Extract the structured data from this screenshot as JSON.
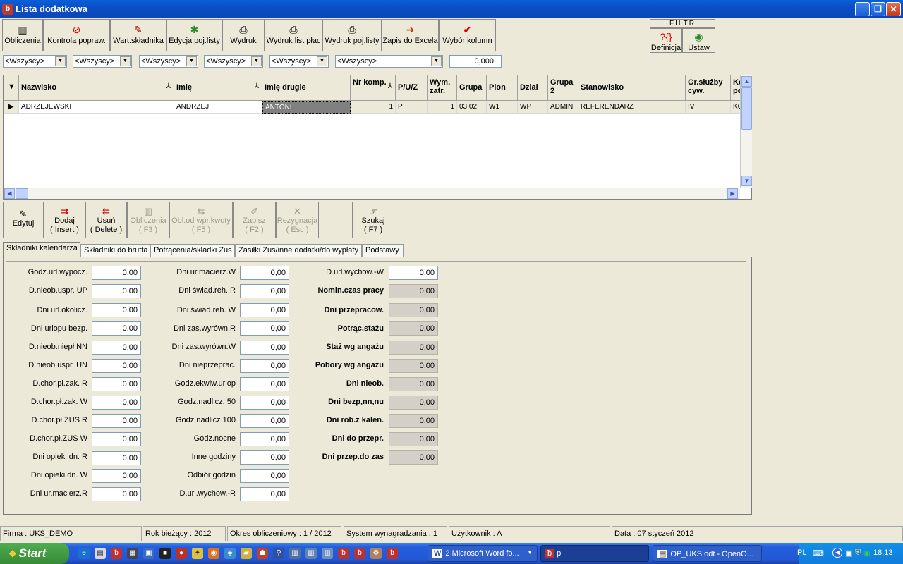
{
  "window": {
    "title": "Lista dodatkowa",
    "app_icon": "app-logo-icon"
  },
  "toolbar": [
    {
      "label": "Obliczenia",
      "icon": "calculator-icon",
      "enabled": true
    },
    {
      "label": "Kontrola popraw.",
      "icon": "no-entry-icon",
      "enabled": true
    },
    {
      "label": "Wart.składnika",
      "icon": "pencil-icon",
      "enabled": true
    },
    {
      "label": "Edycja poj.listy",
      "icon": "edit-list-icon",
      "enabled": true
    },
    {
      "label": "Wydruk",
      "icon": "printer-icon",
      "enabled": true
    },
    {
      "label": "Wydruk list płac",
      "icon": "printer-icon",
      "enabled": true
    },
    {
      "label": "Wydruk poj.listy",
      "icon": "printer-icon",
      "enabled": true
    },
    {
      "label": "Zapis do Excela",
      "icon": "export-icon",
      "enabled": true
    },
    {
      "label": "Wybór kolumn",
      "icon": "checkmark-icon",
      "enabled": true
    }
  ],
  "filter": {
    "title": "FILTR",
    "definition_label": "Definicja",
    "apply_label": "Ustaw"
  },
  "filters": [
    "<Wszyscy>",
    "<Wszyscy>",
    "<Wszyscy>",
    "<Wszyscy>",
    "<Wszyscy>",
    "<Wszyscy>"
  ],
  "amount_value": "0,000",
  "grid": {
    "columns": [
      "Nazwisko",
      "Imię",
      "Imię drugie",
      "Nr komp.",
      "P/U/Z",
      "Wym. zatr.",
      "Grupa",
      "Pion",
      "Dział",
      "Grupa 2",
      "Stanowisko",
      "Gr.służby cyw.",
      "Ko pe"
    ],
    "rows": [
      [
        "ADRZEJEWSKI",
        "ANDRZEJ",
        "ANTONI",
        "1",
        "P",
        "1",
        "03.02",
        "W1",
        "WP",
        "ADMIN",
        "REFERENDARZ",
        "IV",
        "KO"
      ]
    ]
  },
  "bottom_buttons": [
    {
      "label": "Edytuj",
      "icon": "edit-icon",
      "enabled": true
    },
    {
      "label": "Dodaj",
      "shortcut": "( Insert )",
      "icon": "add-icon",
      "enabled": true
    },
    {
      "label": "Usuń",
      "shortcut": "( Delete )",
      "icon": "delete-icon",
      "enabled": true
    },
    {
      "label": "Obliczenia",
      "shortcut": "( F3 )",
      "icon": "calculator-icon",
      "enabled": false
    },
    {
      "label": "Obl.od wpr.kwoty",
      "shortcut": "( F5 )",
      "icon": "calc-amount-icon",
      "enabled": false
    },
    {
      "label": "Zapisz",
      "shortcut": "( F2 )",
      "icon": "save-icon",
      "enabled": false
    },
    {
      "label": "Rezygnacja",
      "shortcut": "( Esc )",
      "icon": "cancel-icon",
      "enabled": false
    },
    {
      "label": "Szukaj",
      "shortcut": "( F7 )",
      "icon": "search-icon",
      "enabled": true
    }
  ],
  "tabs": [
    "Składniki kalendarza",
    "Składniki do brutta",
    "Potrącenia/składki Zus",
    "Zasiłki Zus/inne dodatki/do wypłaty",
    "Podstawy"
  ],
  "fields": {
    "col1": [
      {
        "label": "Godz.url.wypocz.",
        "value": "0,00"
      },
      {
        "label": "D.nieob.uspr. UP",
        "value": "0,00"
      },
      {
        "label": "Dni url.okolicz.",
        "value": "0,00"
      },
      {
        "label": "Dni urlopu bezp.",
        "value": "0,00"
      },
      {
        "label": "D.nieob.niepł.NN",
        "value": "0,00"
      },
      {
        "label": "D.nieob.uspr. UN",
        "value": "0,00"
      },
      {
        "label": "D.chor.pł.zak. R",
        "value": "0,00"
      },
      {
        "label": "D.chor.pł.zak. W",
        "value": "0,00"
      },
      {
        "label": "D.chor.pł.ZUS  R",
        "value": "0,00"
      },
      {
        "label": "D.chor.pł.ZUS  W",
        "value": "0,00"
      },
      {
        "label": "Dni opieki dn. R",
        "value": "0,00"
      },
      {
        "label": "Dni opieki dn. W",
        "value": "0,00"
      },
      {
        "label": "Dni ur.macierz.R",
        "value": "0,00"
      }
    ],
    "col2": [
      {
        "label": "Dni ur.macierz.W",
        "value": "0,00"
      },
      {
        "label": "Dni świad.reh. R",
        "value": "0,00"
      },
      {
        "label": "Dni świad.reh. W",
        "value": "0,00"
      },
      {
        "label": "Dni zas.wyrówn.R",
        "value": "0,00"
      },
      {
        "label": "Dni zas.wyrówn.W",
        "value": "0,00"
      },
      {
        "label": "Dni nieprzeprac.",
        "value": "0,00"
      },
      {
        "label": "Godz.ekwiw.urlop",
        "value": "0,00"
      },
      {
        "label": "Godz.nadlicz. 50",
        "value": "0,00"
      },
      {
        "label": "Godz.nadlicz.100",
        "value": "0,00"
      },
      {
        "label": "Godz.nocne",
        "value": "0,00"
      },
      {
        "label": "Inne godziny",
        "value": "0,00"
      },
      {
        "label": "Odbiór godzin",
        "value": "0,00"
      },
      {
        "label": "D.url.wychow.-R",
        "value": "0,00"
      }
    ],
    "col3": [
      {
        "label": "D.url.wychow.-W",
        "value": "0,00",
        "readonly": false
      },
      {
        "label": "Nomin.czas pracy",
        "value": "0,00",
        "readonly": true
      },
      {
        "label": "Dni przepracow.",
        "value": "0,00",
        "readonly": true
      },
      {
        "label": "Potrąc.stażu",
        "value": "0,00",
        "readonly": true
      },
      {
        "label": "Staż wg angażu",
        "value": "0,00",
        "readonly": true
      },
      {
        "label": "Pobory wg angażu",
        "value": "0,00",
        "readonly": true
      },
      {
        "label": "Dni nieob.",
        "value": "0,00",
        "readonly": true
      },
      {
        "label": "Dni bezp,nn,nu",
        "value": "0,00",
        "readonly": true
      },
      {
        "label": "Dni rob.z kalen.",
        "value": "0,00",
        "readonly": true
      },
      {
        "label": "Dni do przepr.",
        "value": "0,00",
        "readonly": true
      },
      {
        "label": "Dni przep.do zas",
        "value": "0,00",
        "readonly": true
      }
    ]
  },
  "statusbar": [
    "Firma : UKS_DEMO",
    "Rok bieżący : 2012",
    "Okres obliczeniowy : 1 / 2012",
    "System wynagradzania : 1",
    "Użytkownik : A",
    "Data : 07 styczeń 2012"
  ],
  "taskbar": {
    "start_label": "Start",
    "tasks": [
      "2 Microsoft Word fo...",
      "pl",
      "OP_UKS.odt - OpenO..."
    ],
    "language": "PL",
    "clock": "18:13"
  }
}
